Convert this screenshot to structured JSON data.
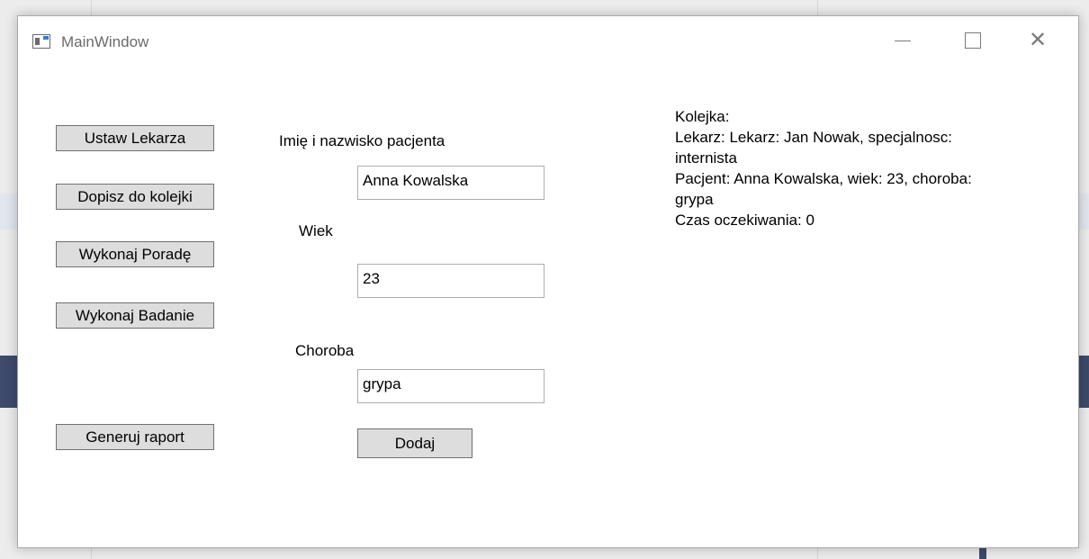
{
  "window": {
    "title": "MainWindow",
    "controls": {
      "minimize_icon": "minimize-icon",
      "maximize_icon": "maximize-icon",
      "close_icon": "close-icon"
    }
  },
  "actions": {
    "set_doctor": "Ustaw Lekarza",
    "add_to_queue": "Dopisz do kolejki",
    "do_consultation": "Wykonaj Poradę",
    "do_examination": "Wykonaj Badanie",
    "generate_report": "Generuj raport"
  },
  "form": {
    "name_label": "Imię i nazwisko pacjenta",
    "name_value": "Anna Kowalska",
    "age_label": "Wiek",
    "age_value": "23",
    "disease_label": "Choroba",
    "disease_value": "grypa",
    "add_button": "Dodaj"
  },
  "queue": {
    "heading": "Kolejka:",
    "doctor_line_1": "Lekarz: Lekarz: Jan Nowak, specjalnosc:",
    "doctor_line_2": "internista",
    "patient_line_1": "Pacjent: Anna Kowalska, wiek: 23, choroba:",
    "patient_line_2": "grypa",
    "wait_time": "Czas oczekiwania: 0"
  },
  "colors": {
    "button_bg": "#dddddd",
    "window_bg": "#ffffff",
    "accent_blue": "#2f7fd6"
  }
}
